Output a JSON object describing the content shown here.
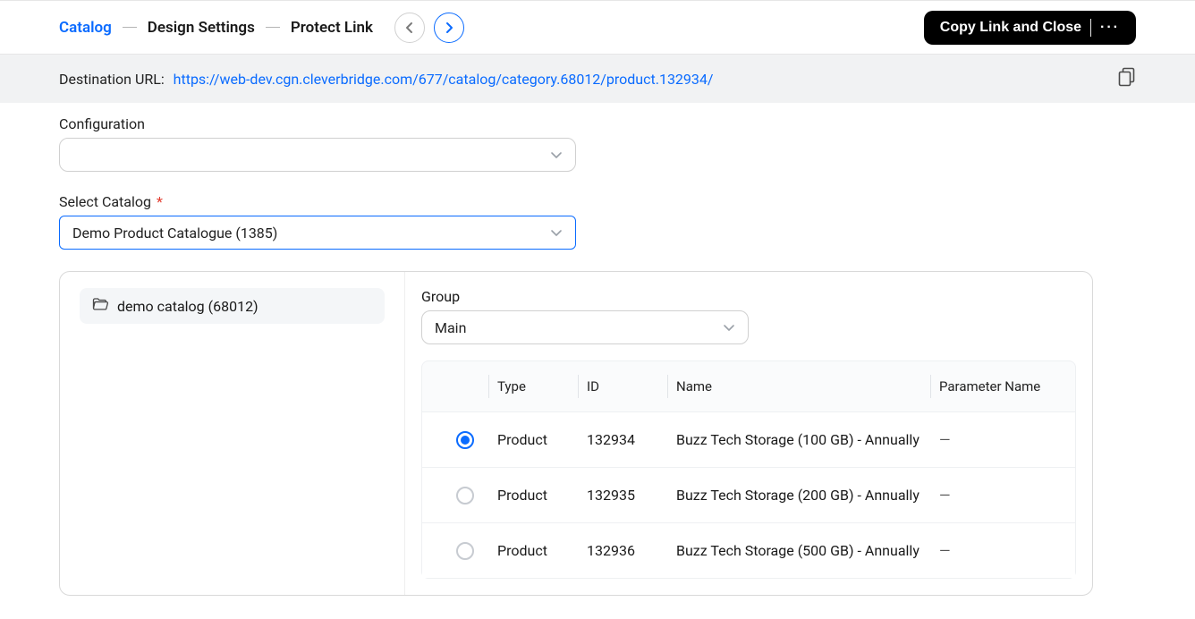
{
  "header": {
    "breadcrumb": [
      "Catalog",
      "Design Settings",
      "Protect Link"
    ],
    "active_index": 0,
    "copy_close_label": "Copy Link and Close",
    "more_glyph": "···"
  },
  "url_bar": {
    "label": "Destination URL:",
    "url": "https://web-dev.cgn.cleverbridge.com/677/catalog/category.68012/product.132934/"
  },
  "fields": {
    "configuration": {
      "label": "Configuration",
      "value": ""
    },
    "select_catalog": {
      "label": "Select Catalog",
      "required": true,
      "value": "Demo Product Catalogue (1385)"
    }
  },
  "tree": {
    "items": [
      {
        "label": "demo catalog (68012)"
      }
    ]
  },
  "group": {
    "label": "Group",
    "value": "Main"
  },
  "table": {
    "columns": {
      "type": "Type",
      "id": "ID",
      "name": "Name",
      "param": "Parameter Name"
    },
    "rows": [
      {
        "selected": true,
        "type": "Product",
        "id": "132934",
        "name": "Buzz Tech Storage (100 GB) - Annually",
        "param": "—"
      },
      {
        "selected": false,
        "type": "Product",
        "id": "132935",
        "name": "Buzz Tech Storage (200 GB) - Annually",
        "param": "—"
      },
      {
        "selected": false,
        "type": "Product",
        "id": "132936",
        "name": "Buzz Tech Storage (500 GB) - Annually",
        "param": "—"
      }
    ]
  }
}
